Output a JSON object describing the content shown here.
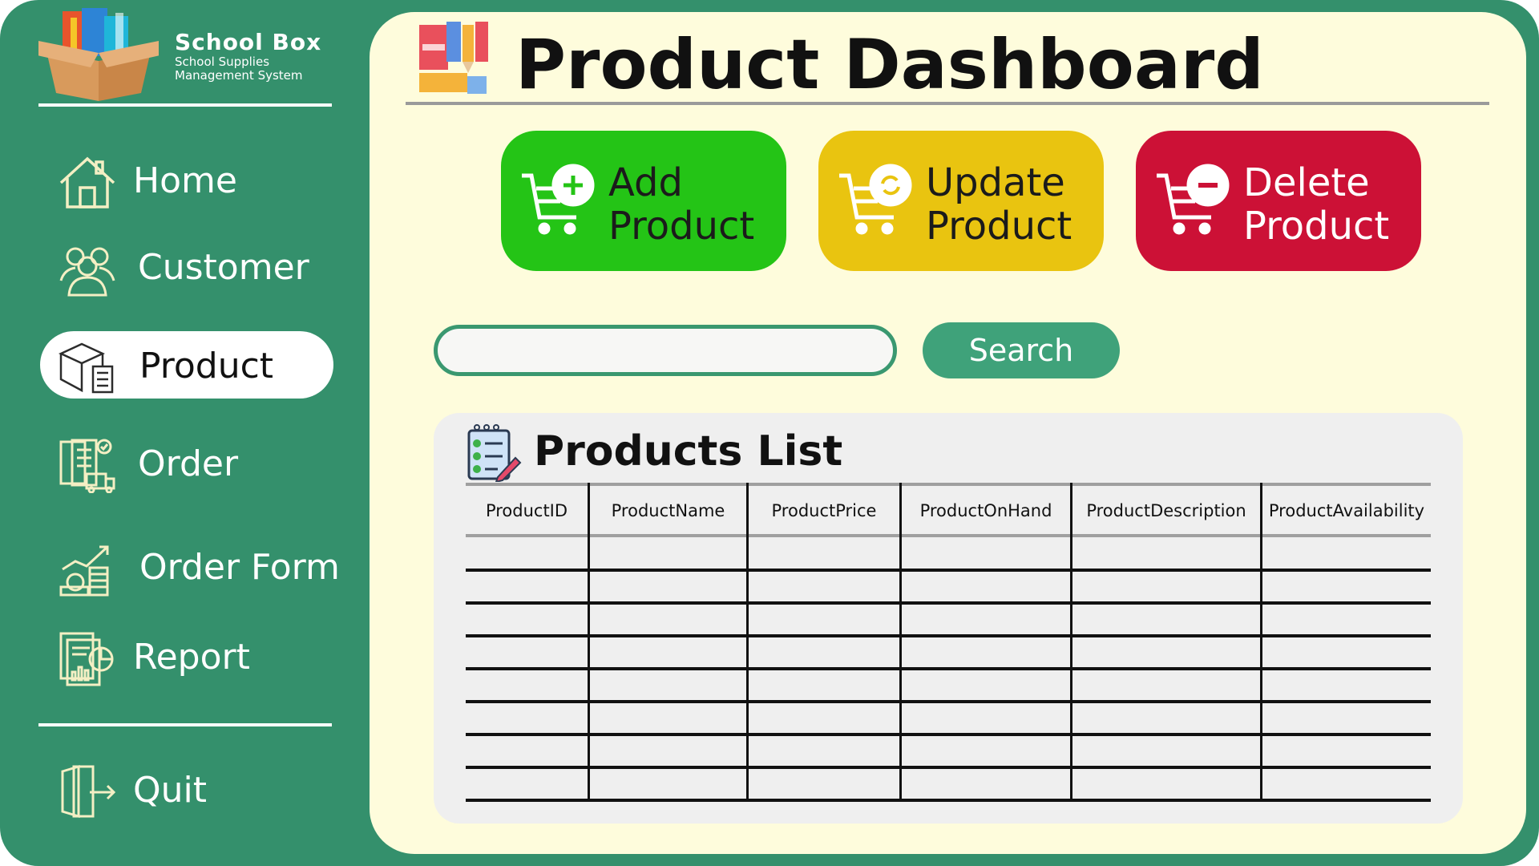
{
  "brand": {
    "title": "School Box",
    "subtitle_line1": "School Supplies",
    "subtitle_line2": "Management System"
  },
  "nav": {
    "items": [
      {
        "label": "Home",
        "icon": "home-icon"
      },
      {
        "label": "Customer",
        "icon": "customers-icon"
      },
      {
        "label": "Product",
        "icon": "product-box-icon",
        "active": true
      },
      {
        "label": "Order",
        "icon": "order-clipboard-icon"
      },
      {
        "label": "Order Form",
        "icon": "order-form-chart-icon"
      },
      {
        "label": "Report",
        "icon": "report-icon"
      }
    ],
    "quit": {
      "label": "Quit",
      "icon": "exit-door-icon"
    }
  },
  "header": {
    "title": "Product Dashboard",
    "icon": "school-supplies-icon"
  },
  "actions": {
    "add": {
      "line1": "Add",
      "line2": "Product",
      "color": "#24c416",
      "icon": "cart-add-icon"
    },
    "update": {
      "line1": "Update",
      "line2": "Product",
      "color": "#e9c410",
      "icon": "cart-update-icon"
    },
    "delete": {
      "line1": "Delete",
      "line2": "Product",
      "color": "#cc1136",
      "icon": "cart-remove-icon"
    }
  },
  "search": {
    "value": "",
    "placeholder": "",
    "button_label": "Search"
  },
  "products_list": {
    "title": "Products List",
    "icon": "checklist-icon",
    "columns": [
      "ProductID",
      "ProductName",
      "ProductPrice",
      "ProductOnHand",
      "ProductDescription",
      "ProductAvailability"
    ],
    "rows": [
      [
        "",
        "",
        "",
        "",
        "",
        ""
      ],
      [
        "",
        "",
        "",
        "",
        "",
        ""
      ],
      [
        "",
        "",
        "",
        "",
        "",
        ""
      ],
      [
        "",
        "",
        "",
        "",
        "",
        ""
      ],
      [
        "",
        "",
        "",
        "",
        "",
        ""
      ],
      [
        "",
        "",
        "",
        "",
        "",
        ""
      ],
      [
        "",
        "",
        "",
        "",
        "",
        ""
      ],
      [
        "",
        "",
        "",
        "",
        "",
        ""
      ]
    ]
  },
  "colors": {
    "sidebar": "#34906c",
    "main_bg": "#fefcdc",
    "accent": "#3fa27a",
    "add": "#24c416",
    "update": "#e9c410",
    "delete": "#cc1136"
  }
}
